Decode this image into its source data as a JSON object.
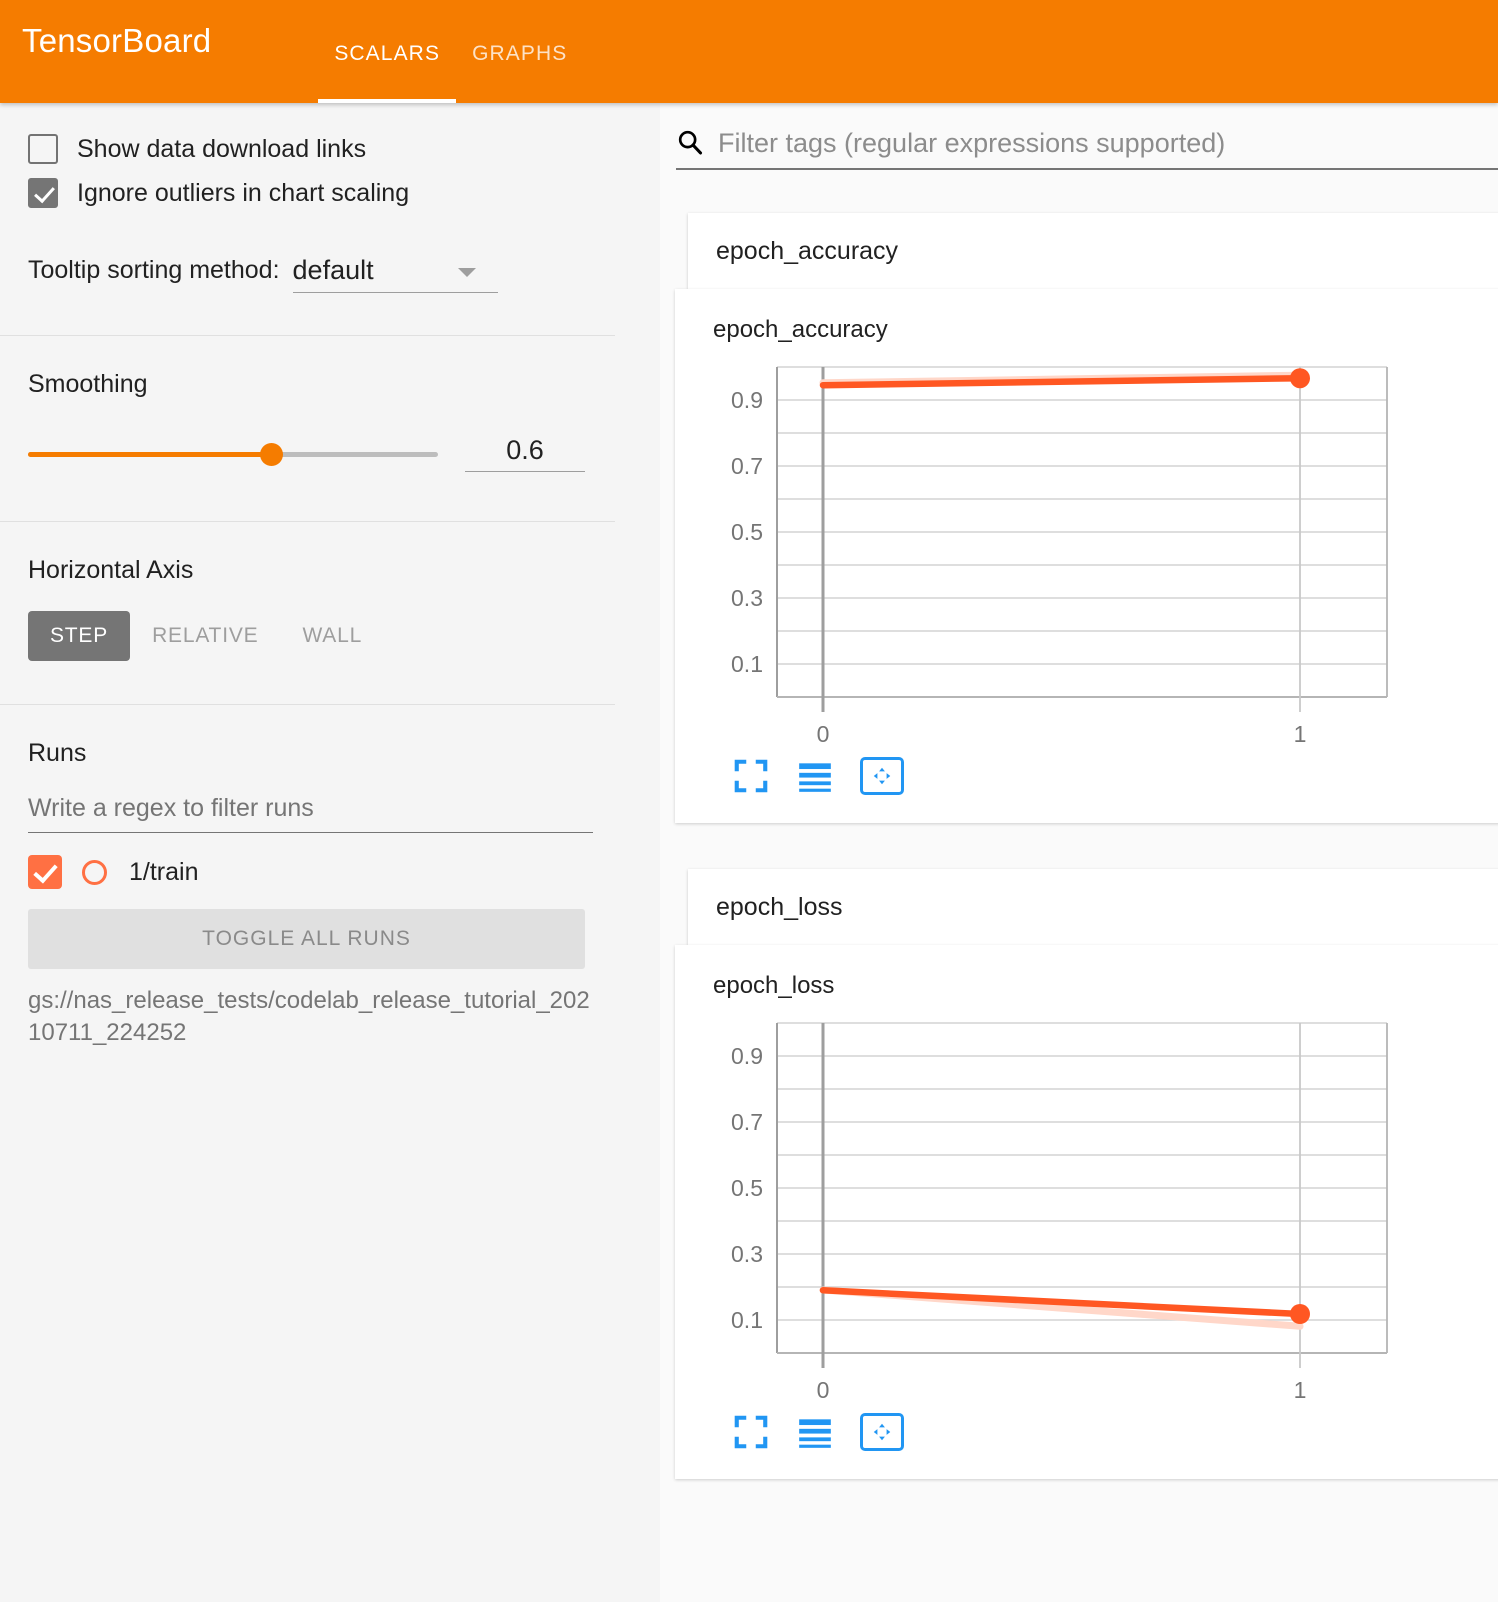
{
  "header": {
    "brand": "TensorBoard",
    "tabs": [
      {
        "label": "SCALARS",
        "active": true
      },
      {
        "label": "GRAPHS",
        "active": false
      }
    ]
  },
  "sidebar": {
    "options": [
      {
        "label": "Show data download links",
        "checked": false
      },
      {
        "label": "Ignore outliers in chart scaling",
        "checked": true
      }
    ],
    "tooltip_sorting": {
      "label": "Tooltip sorting method:",
      "value": "default"
    },
    "smoothing": {
      "title": "Smoothing",
      "value": "0.6",
      "fraction": 0.6
    },
    "horizontal_axis": {
      "title": "Horizontal Axis",
      "buttons": [
        {
          "label": "STEP",
          "active": true
        },
        {
          "label": "RELATIVE",
          "active": false
        },
        {
          "label": "WALL",
          "active": false
        }
      ]
    },
    "runs": {
      "title": "Runs",
      "filter_placeholder": "Write a regex to filter runs",
      "items": [
        {
          "name": "1/train",
          "checked": true,
          "color": "#ff7043"
        }
      ],
      "toggle_all_label": "TOGGLE ALL RUNS",
      "logdir": "gs://nas_release_tests/codelab_release_tutorial_20210711_224252"
    }
  },
  "main": {
    "search": {
      "placeholder": "Filter tags (regular expressions supported)",
      "icon": "search-icon"
    },
    "cards": [
      {
        "tag": "epoch_accuracy",
        "chart_title": "epoch_accuracy"
      },
      {
        "tag": "epoch_loss",
        "chart_title": "epoch_loss"
      }
    ],
    "chart_tools": [
      {
        "name": "expand-icon",
        "label": ""
      },
      {
        "name": "data-table-icon",
        "label": ""
      },
      {
        "name": "pan-fit-icon",
        "label": ""
      }
    ]
  },
  "colors": {
    "brand_orange": "#f57c00",
    "series_orange": "#ff5722",
    "series_faint": "#ffd7c9",
    "tool_blue": "#2196f3"
  },
  "chart_data": [
    {
      "type": "line",
      "title": "epoch_accuracy",
      "xlabel": "",
      "ylabel": "",
      "x": [
        0,
        1
      ],
      "xticks": [
        0,
        1
      ],
      "xticklabels": [
        "0",
        "1"
      ],
      "xlim": [
        -0.08,
        1.18
      ],
      "ylim": [
        0.0,
        1.0
      ],
      "yticks": [
        0.1,
        0.3,
        0.5,
        0.7,
        0.9
      ],
      "yticklabels": [
        "0.9",
        "0.7",
        "0.5",
        "0.3",
        "0.1"
      ],
      "gridlines": [
        0.1,
        0.2,
        0.3,
        0.4,
        0.5,
        0.6,
        0.7,
        0.8,
        0.9,
        1.0
      ],
      "grid": true,
      "legend": "none",
      "series": [
        {
          "name": "1/train (smoothed)",
          "values": [
            0.945,
            0.966
          ],
          "color": "#ff5722",
          "emphasis": "solid"
        },
        {
          "name": "1/train (raw)",
          "values": [
            0.952,
            0.975
          ],
          "color": "#ffd7c9",
          "emphasis": "faded"
        }
      ],
      "markers": [
        {
          "x": 1,
          "y": 0.966
        }
      ]
    },
    {
      "type": "line",
      "title": "epoch_loss",
      "xlabel": "",
      "ylabel": "",
      "x": [
        0,
        1
      ],
      "xticks": [
        0,
        1
      ],
      "xticklabels": [
        "0",
        "1"
      ],
      "xlim": [
        -0.08,
        1.18
      ],
      "ylim": [
        0.0,
        1.0
      ],
      "yticks": [
        0.1,
        0.3,
        0.5,
        0.7,
        0.9
      ],
      "yticklabels": [
        "0.9",
        "0.7",
        "0.5",
        "0.3",
        "0.1"
      ],
      "gridlines": [
        0.1,
        0.2,
        0.3,
        0.4,
        0.5,
        0.6,
        0.7,
        0.8,
        0.9,
        1.0
      ],
      "grid": true,
      "legend": "none",
      "series": [
        {
          "name": "1/train (smoothed)",
          "values": [
            0.19,
            0.118
          ],
          "color": "#ff5722",
          "emphasis": "solid"
        },
        {
          "name": "1/train (raw)",
          "values": [
            0.188,
            0.078
          ],
          "color": "#ffd7c9",
          "emphasis": "faded"
        }
      ],
      "markers": [
        {
          "x": 1,
          "y": 0.118
        }
      ]
    }
  ]
}
